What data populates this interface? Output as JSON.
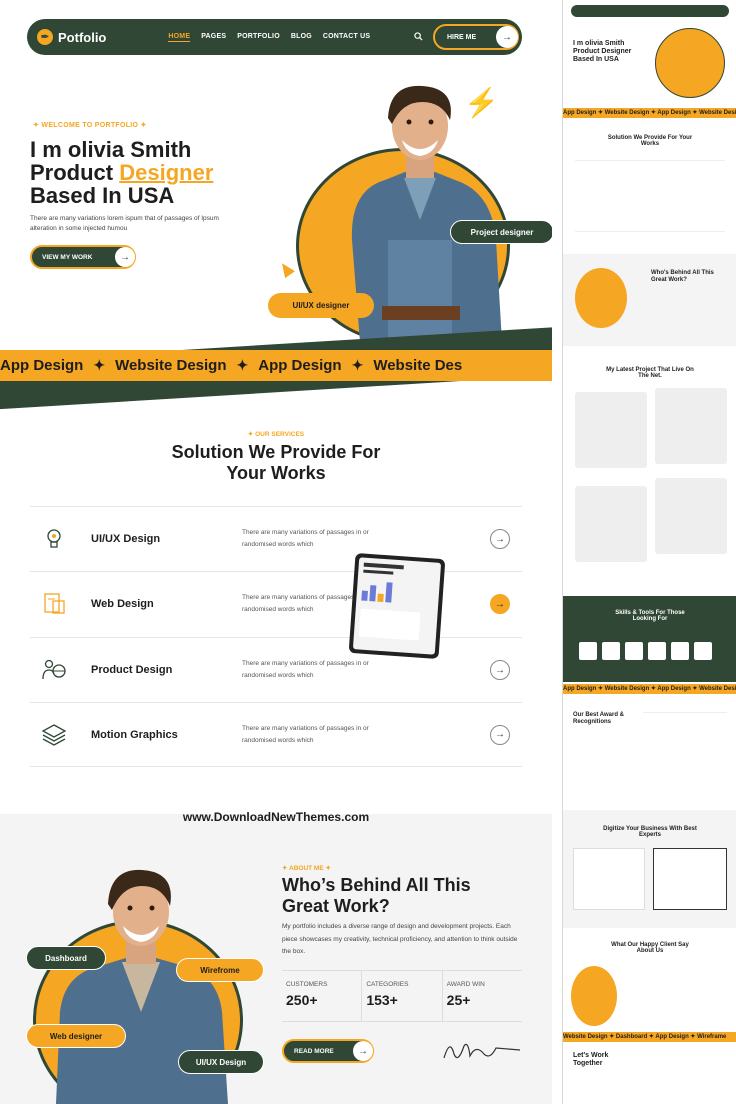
{
  "nav": {
    "brand": "Potfolio",
    "menu": [
      "HOME",
      "PAGES",
      "PORTFOLIO",
      "BLOG",
      "CONTACT US"
    ],
    "hire_label": "HIRE ME"
  },
  "hero": {
    "eyebrow": "WELCOME TO PORTFOLIO",
    "title_line1": "I m olivia Smith",
    "title_line2_a": "Product ",
    "title_line2_b": "Designer",
    "title_line3": "Based In USA",
    "description": "There are many variations lorem ispum that of passages of Ipsum alteration in some injected humou",
    "cta_label": "VIEW MY WORK",
    "tag_project": "Project designer",
    "tag_uiux": "UI/UX designer"
  },
  "marquee": [
    "App Design",
    "Website Design",
    "App Design",
    "Website Des"
  ],
  "services": {
    "eyebrow": "OUR SERVICES",
    "title_line1": "Solution We Provide For",
    "title_line2": "Your Works",
    "items": [
      {
        "name": "UI/UX Design",
        "desc": "There are many variations of passages in or randomised words which",
        "icon": "lightbulb-icon",
        "active": false
      },
      {
        "name": "Web Design",
        "desc": "There are many variations of passages in or randomised words which",
        "icon": "web-design-icon",
        "active": true
      },
      {
        "name": "Product Design",
        "desc": "There are many variations of passages in or randomised words which",
        "icon": "product-globe-icon",
        "active": false
      },
      {
        "name": "Motion Graphics",
        "desc": "There are many variations of passages in or randomised words which",
        "icon": "layers-icon",
        "active": false
      }
    ]
  },
  "watermark": "www.DownloadNewThemes.com",
  "about": {
    "eyebrow": "ABOUT ME",
    "title_line1": "Who’s Behind All This",
    "title_line2": "Great Work?",
    "description": "My portfolio includes a diverse range of design and development projects. Each piece showcases my creativity, technical proficiency, and attention to think outside the box.",
    "stats": [
      {
        "label": "CUSTOMERS",
        "value": "250+"
      },
      {
        "label": "CATEGORIES",
        "value": "153+"
      },
      {
        "label": "AWARD WIN",
        "value": "25+"
      }
    ],
    "cta_label": "READ MORE",
    "tags": {
      "dashboard": "Dashboard",
      "wireframe": "Wirefrome",
      "web": "Web designer",
      "uiux": "UI/UX Design"
    }
  },
  "preview": {
    "hero_line1": "I m olivia Smith",
    "hero_line2": "Product Designer",
    "hero_line3": "Based In USA",
    "strip1": "App Design  ✦  Website Design  ✦  App Design  ✦  Website Design",
    "services_title": "Solution We Provide For Your Works",
    "about_title": "Who's Behind All This Great Work?",
    "projects_title": "My Latest Project That Live On The Net.",
    "skills_title": "Skills & Tools For Those Looking For",
    "strip2": "App Design  ✦  Website Design  ✦  App Design  ✦  Website Design",
    "award_title": "Our Best Award & Recognitions",
    "experts_title": "Digitize Your Business With Best Experts",
    "clients_title": "What Our Happy Client Say About Us",
    "strip3": "Website Design  ✦  Dashboard  ✦  App Design  ✦  Wireframe",
    "together": "Let's Work Together"
  },
  "colors": {
    "green": "#2f4734",
    "yellow": "#f5a623"
  }
}
